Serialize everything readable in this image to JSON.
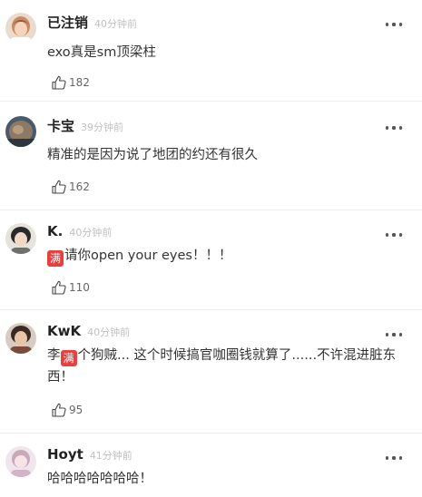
{
  "comments": [
    {
      "username": "已注销",
      "time": "40分钟前",
      "text": "exo真是sm顶梁柱",
      "likes": "182",
      "avatar_icon": "avatar-icon"
    },
    {
      "username": "卡宝",
      "time": "39分钟前",
      "text": "精准的是因为说了地团的约还有很久",
      "likes": "162",
      "avatar_icon": "avatar-icon"
    },
    {
      "username": "K.",
      "time": "40分钟前",
      "badge": "满",
      "text": "请你open your eyes！！！",
      "likes": "110",
      "avatar_icon": "avatar-icon"
    },
    {
      "username": "KwK",
      "time": "40分钟前",
      "text_prefix": "李",
      "badge": "满",
      "text": "个狗贼... 这个时候搞官咖圈钱就算了......不许混进脏东西！",
      "likes": "95",
      "avatar_icon": "avatar-icon"
    },
    {
      "username": "Hoyt",
      "time": "41分钟前",
      "text": "哈哈哈哈哈哈哈！",
      "avatar_icon": "avatar-icon"
    }
  ],
  "icons": {
    "more": "more-icon",
    "like": "thumbs-up-icon"
  },
  "colors": {
    "badge": "#e8403e",
    "username": "#222222",
    "time": "#c0c0c0",
    "text": "#333333",
    "divider": "#eeeeee"
  }
}
